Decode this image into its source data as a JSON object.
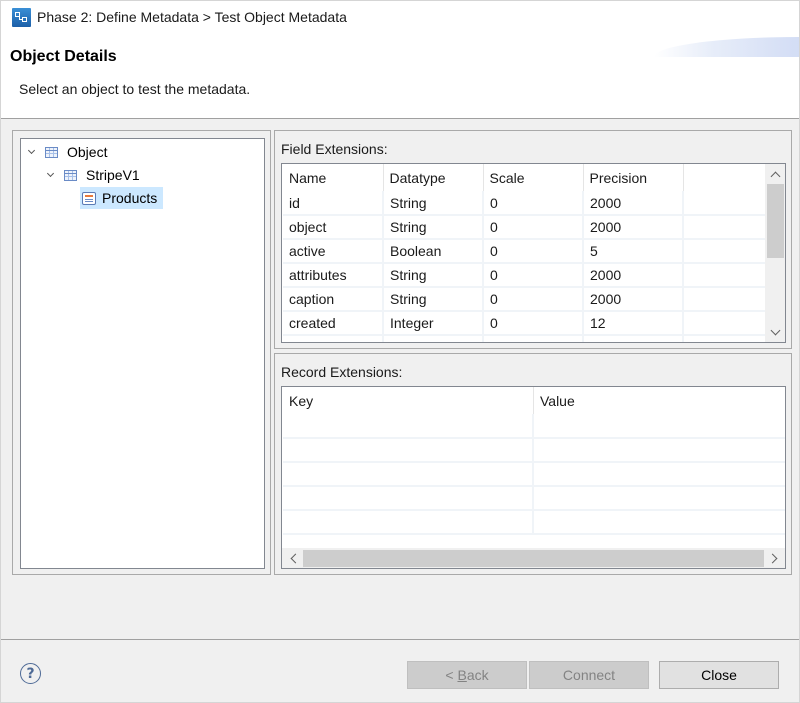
{
  "window": {
    "title": "Phase 2: Define Metadata > Test Object Metadata",
    "icon": "metadata-wizard-icon"
  },
  "header": {
    "title": "Object Details",
    "description": "Select an object to test the metadata."
  },
  "tree": {
    "items": [
      {
        "label": "Object",
        "icon": "table-icon",
        "expanded": true,
        "level": 0
      },
      {
        "label": "StripeV1",
        "icon": "table-icon",
        "expanded": true,
        "level": 1
      },
      {
        "label": "Products",
        "icon": "object-table-icon",
        "selected": true,
        "level": 2
      }
    ]
  },
  "field_extensions": {
    "label": "Field Extensions:",
    "columns": [
      "Name",
      "Datatype",
      "Scale",
      "Precision",
      ""
    ],
    "rows": [
      [
        "id",
        "String",
        "0",
        "2000",
        ""
      ],
      [
        "object",
        "String",
        "0",
        "2000",
        ""
      ],
      [
        "active",
        "Boolean",
        "0",
        "5",
        ""
      ],
      [
        "attributes",
        "String",
        "0",
        "2000",
        ""
      ],
      [
        "caption",
        "String",
        "0",
        "2000",
        ""
      ],
      [
        "created",
        "Integer",
        "0",
        "12",
        ""
      ]
    ]
  },
  "record_extensions": {
    "label": "Record Extensions:",
    "columns": [
      "Key",
      "Value"
    ],
    "rows": []
  },
  "footer": {
    "help_icon": "help-icon",
    "back_prefix": "< ",
    "back_mnemonic": "B",
    "back_rest": "ack",
    "connect_label": "Connect",
    "close_label": "Close"
  }
}
